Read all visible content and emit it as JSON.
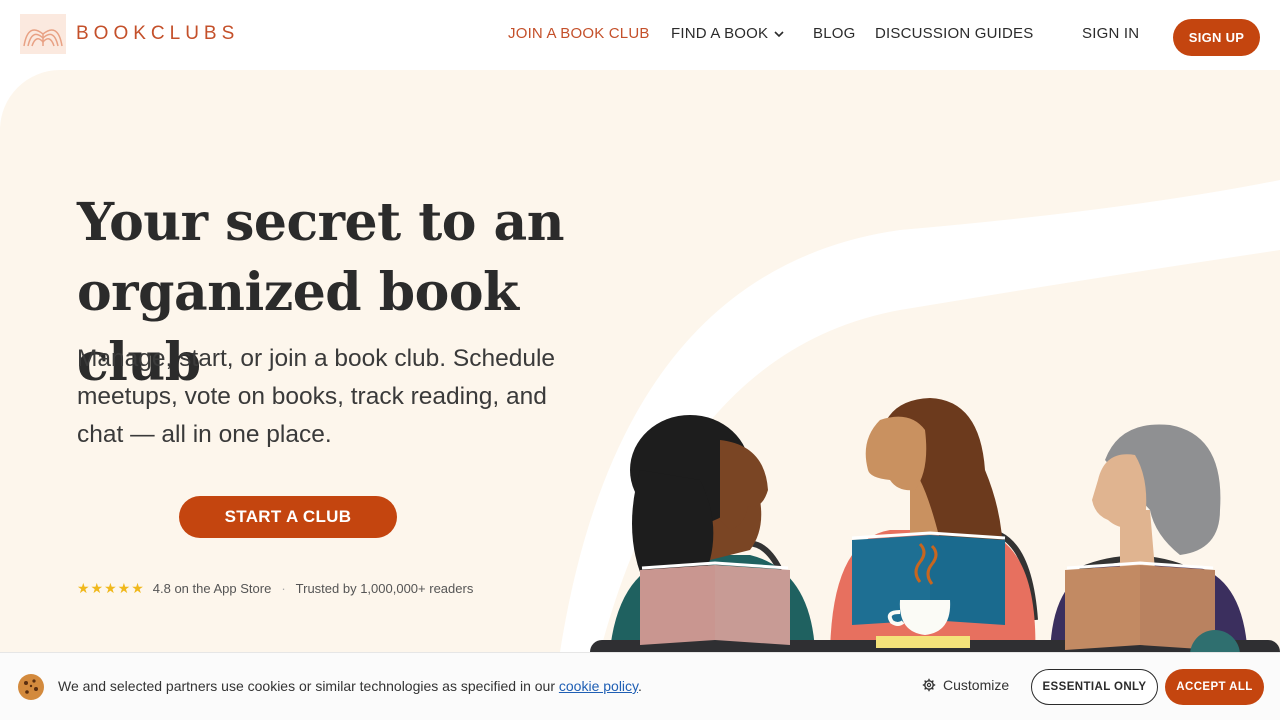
{
  "brand": {
    "name": "BOOKCLUBS",
    "color": "#c4502a",
    "accent_button": "#c4450f"
  },
  "nav": {
    "join": "JOIN A BOOK CLUB",
    "find": "FIND A BOOK",
    "blog": "BLOG",
    "guides": "DISCUSSION GUIDES",
    "signin": "SIGN IN",
    "signup": "SIGN UP"
  },
  "hero": {
    "headline_line1": "Your secret to an",
    "headline_line2": "organized book club",
    "subtext": "Manage, start, or join a book club. Schedule meetups, vote on books, track reading, and chat — all in one place.",
    "cta": "START A CLUB",
    "stars": "★★★★★",
    "rating": "4.8 on the App Store",
    "separator": "·",
    "trusted": "Trusted by 1,000,000+ readers"
  },
  "cookie": {
    "text": "We and selected partners use cookies or similar technologies as specified in our",
    "link": "cookie policy",
    "period": ".",
    "customize": "Customize",
    "essential": "ESSENTIAL ONLY",
    "accept": "ACCEPT ALL"
  }
}
